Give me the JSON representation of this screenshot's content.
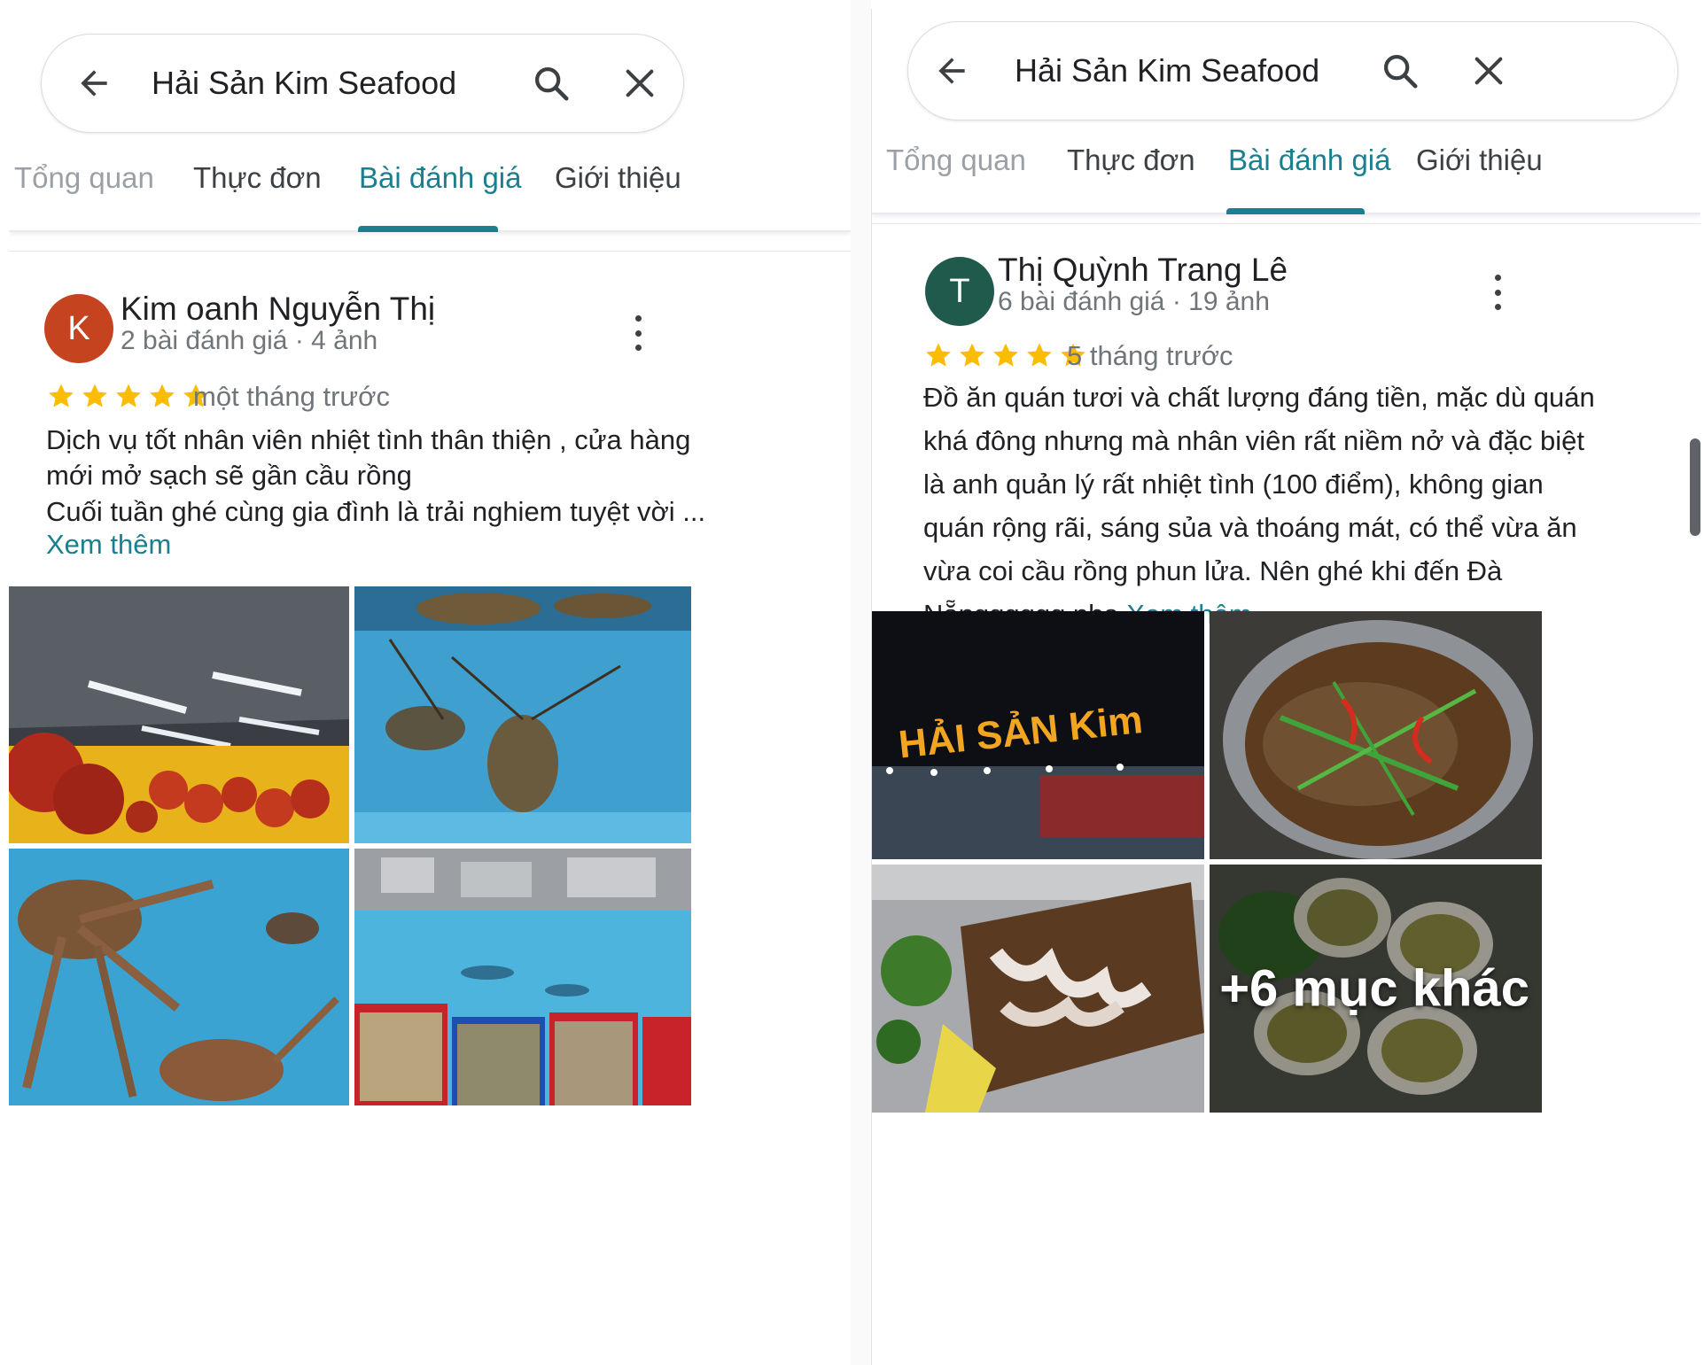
{
  "colors": {
    "accent": "#1a7f8e",
    "star": "#fbbc04",
    "avatar_k": "#c5441f",
    "avatar_t": "#1f5a4d"
  },
  "left": {
    "search": {
      "query": "Hải Sản Kim Seafood"
    },
    "icons": {
      "back": "arrow-left-icon",
      "search": "magnifier-icon",
      "close": "close-x-icon"
    },
    "tabs": [
      "Tổng quan",
      "Thực đơn",
      "Bài đánh giá",
      "Giới thiệu"
    ],
    "active_tab": "Bài đánh giá",
    "review": {
      "avatar_letter": "K",
      "name": "Kim oanh Nguyễn Thị",
      "meta": "2 bài đánh giá · 4 ảnh",
      "rating": 5,
      "time": "một tháng trước",
      "lines": [
        "Dịch vụ tốt nhân viên nhiệt tình thân thiện , cửa hàng",
        "mới mở sạch sẽ gần cầu rồng",
        "Cuối tuần ghé cùng gia đình là trải nghiem tuyệt vời ..."
      ],
      "more": "Xem thêm",
      "photos": [
        "restaurant-interior-photo",
        "lobster-tank-photo",
        "king-crab-tank-photo",
        "seafood-tank-baskets-photo"
      ]
    }
  },
  "right": {
    "search": {
      "query": "Hải Sản Kim Seafood"
    },
    "icons": {
      "back": "arrow-left-icon",
      "search": "magnifier-icon",
      "close": "close-x-icon"
    },
    "tabs": [
      "Tổng quan",
      "Thực đơn",
      "Bài đánh giá",
      "Giới thiệu"
    ],
    "active_tab": "Bài đánh giá",
    "review": {
      "avatar_letter": "T",
      "name": "Thị Quỳnh Trang Lê",
      "meta": "6 bài đánh giá · 19 ảnh",
      "rating": 5,
      "time": "5 tháng trước",
      "lines": [
        "Đồ ăn quán tươi và chất lượng đáng tiền, mặc dù quán",
        "khá đông nhưng mà nhân viên rất niềm nở và đặc biệt",
        "là anh quản lý rất nhiệt tình (100 điểm), không gian",
        "quán rộng rãi, sáng sủa và thoáng mát, có thể vừa ăn",
        "vừa coi cầu rồng phun lửa. Nên ghé khi đến Đà"
      ],
      "last_line": "Nẵngggggg nha",
      "more": "Xem thêm",
      "photos": [
        "storefront-sign-photo",
        "steamed-fish-photo",
        "squid-platter-photo",
        "grilled-oysters-photo"
      ],
      "sign_text": "HẢI SẢN Kim",
      "more_photos": "+6 mục khác"
    }
  }
}
